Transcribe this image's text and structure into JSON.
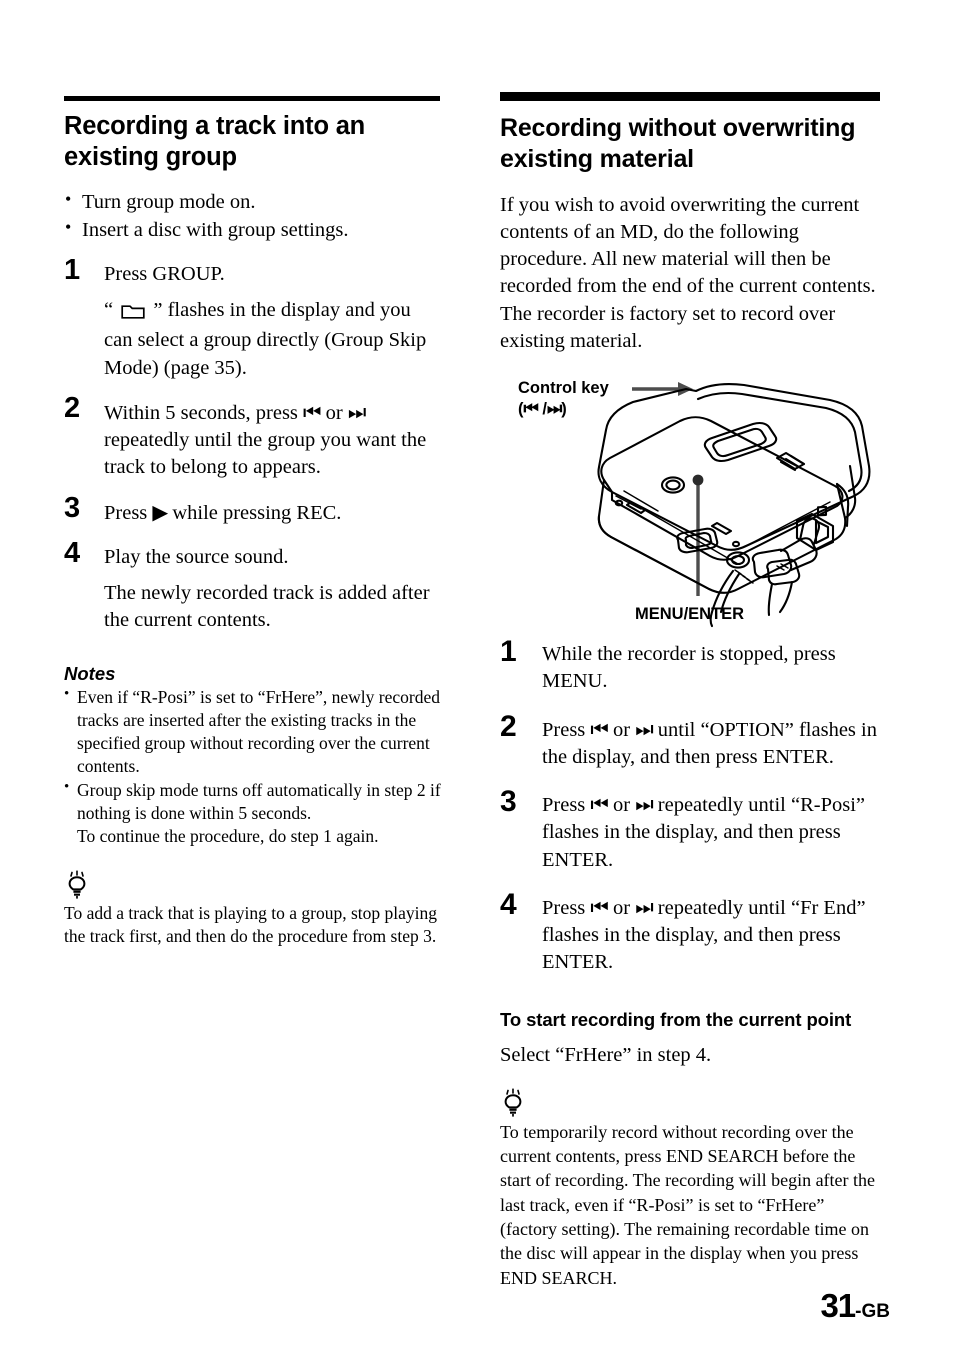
{
  "page": {
    "folio_number": "31",
    "folio_suffix": "-GB",
    "accent_color": "#000000",
    "leader_color": "#4d4d4d"
  },
  "left_column": {
    "heading": "Recording a track into an existing group",
    "prereq_bullets": [
      "Turn group mode on.",
      "Insert a disc with group settings."
    ],
    "steps": [
      {
        "num": "1",
        "text": "Press GROUP.",
        "sub_pre": "“",
        "sub_icon": "folder-icon",
        "sub_post": "” flashes in the display and you can select a group directly (Group Skip Mode) (page 35)."
      },
      {
        "num": "2",
        "text_pre": "Within 5 seconds, press ",
        "glyph_prev": "⏮",
        "text_mid": " or ",
        "glyph_next": "⏭",
        "text_post": " repeatedly until the group you want the track to belong to appears."
      },
      {
        "num": "3",
        "text_pre": "Press ",
        "glyph_play": "▶",
        "text_post": " while pressing REC."
      },
      {
        "num": "4",
        "text": "Play the source sound.",
        "sub_post": "The newly recorded track is added after the current contents."
      }
    ],
    "notes_heading": "Notes",
    "notes": [
      "Even if “R-Posi” is set to “FrHere”, newly recorded tracks are inserted after the existing tracks in the specified group without recording over the current contents.",
      "Group skip mode turns off automatically in step 2 if nothing is done within 5 seconds.",
      "To continue the procedure, do step 1 again."
    ],
    "tip_icon": "lightbulb-icon",
    "tip_text": "To add a track that is playing to a group, stop playing the track first, and then do the procedure from step 3."
  },
  "right_column": {
    "heading": "Recording without overwriting existing material",
    "intro": "If you wish to avoid overwriting the current contents of an MD, do the following procedure. All new material will then be recorded from the end of the current contents. The recorder is factory set to record over existing material.",
    "figure": {
      "alt_name": "md-recorder-illustration",
      "label_control_line1": "Control key",
      "label_control_line2_open": "(",
      "label_control_glyph_prev": "⏮",
      "label_control_slash": " /",
      "label_control_glyph_next": "⏭",
      "label_control_line2_close": ")",
      "label_menu_enter": "MENU/ENTER"
    },
    "steps": [
      {
        "num": "1",
        "text": "While the recorder is stopped, press MENU."
      },
      {
        "num": "2",
        "text_pre": "Press ",
        "glyph_prev": "⏮",
        "text_mid": " or ",
        "glyph_next": "⏭",
        "text_post": " until “OPTION” flashes in the display, and then press ENTER."
      },
      {
        "num": "3",
        "text_pre": "Press ",
        "glyph_prev": "⏮",
        "text_mid": " or ",
        "glyph_next": "⏭",
        "text_post": " repeatedly until “R-Posi” flashes in the display, and then press ENTER."
      },
      {
        "num": "4",
        "text_pre": "Press ",
        "glyph_prev": "⏮",
        "text_mid": " or ",
        "glyph_next": "⏭",
        "text_post": " repeatedly until “Fr End” flashes in the display, and then press ENTER."
      }
    ],
    "subheading": "To start recording from the current point",
    "sub_body": "Select “FrHere” in step 4.",
    "tip_icon": "lightbulb-icon",
    "tip_text": "To temporarily record without recording over the current contents, press END SEARCH before the start of recording. The recording will begin after the last track, even if “R-Posi” is set to “FrHere” (factory setting). The remaining recordable time on the disc will appear in the display when you press END SEARCH."
  }
}
